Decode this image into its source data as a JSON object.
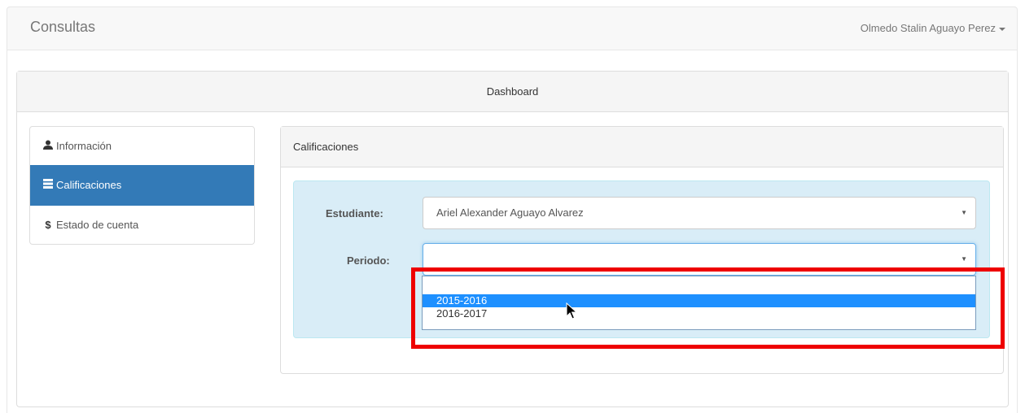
{
  "navbar": {
    "brand": "Consultas",
    "user_name": "Olmedo Stalin Aguayo Perez"
  },
  "panel": {
    "heading": "Dashboard"
  },
  "sidebar": {
    "items": [
      {
        "label": "Información",
        "icon": "user-icon",
        "active": false
      },
      {
        "label": "Calificaciones",
        "icon": "list-icon",
        "active": true
      },
      {
        "label": "Estado de cuenta",
        "icon": "dollar-icon",
        "active": false
      }
    ]
  },
  "grades": {
    "heading": "Calificaciones",
    "student_label": "Estudiante:",
    "student_value": "Ariel Alexander Aguayo Alvarez",
    "period_label": "Periodo:",
    "period_value": "",
    "period_options": [
      "",
      "2015-2016",
      "2016-2017"
    ],
    "period_highlighted": "2015-2016"
  },
  "colors": {
    "active": "#337ab7",
    "well": "#d9edf7",
    "highlight_option": "#1e90ff",
    "annotation": "#ee0000"
  }
}
